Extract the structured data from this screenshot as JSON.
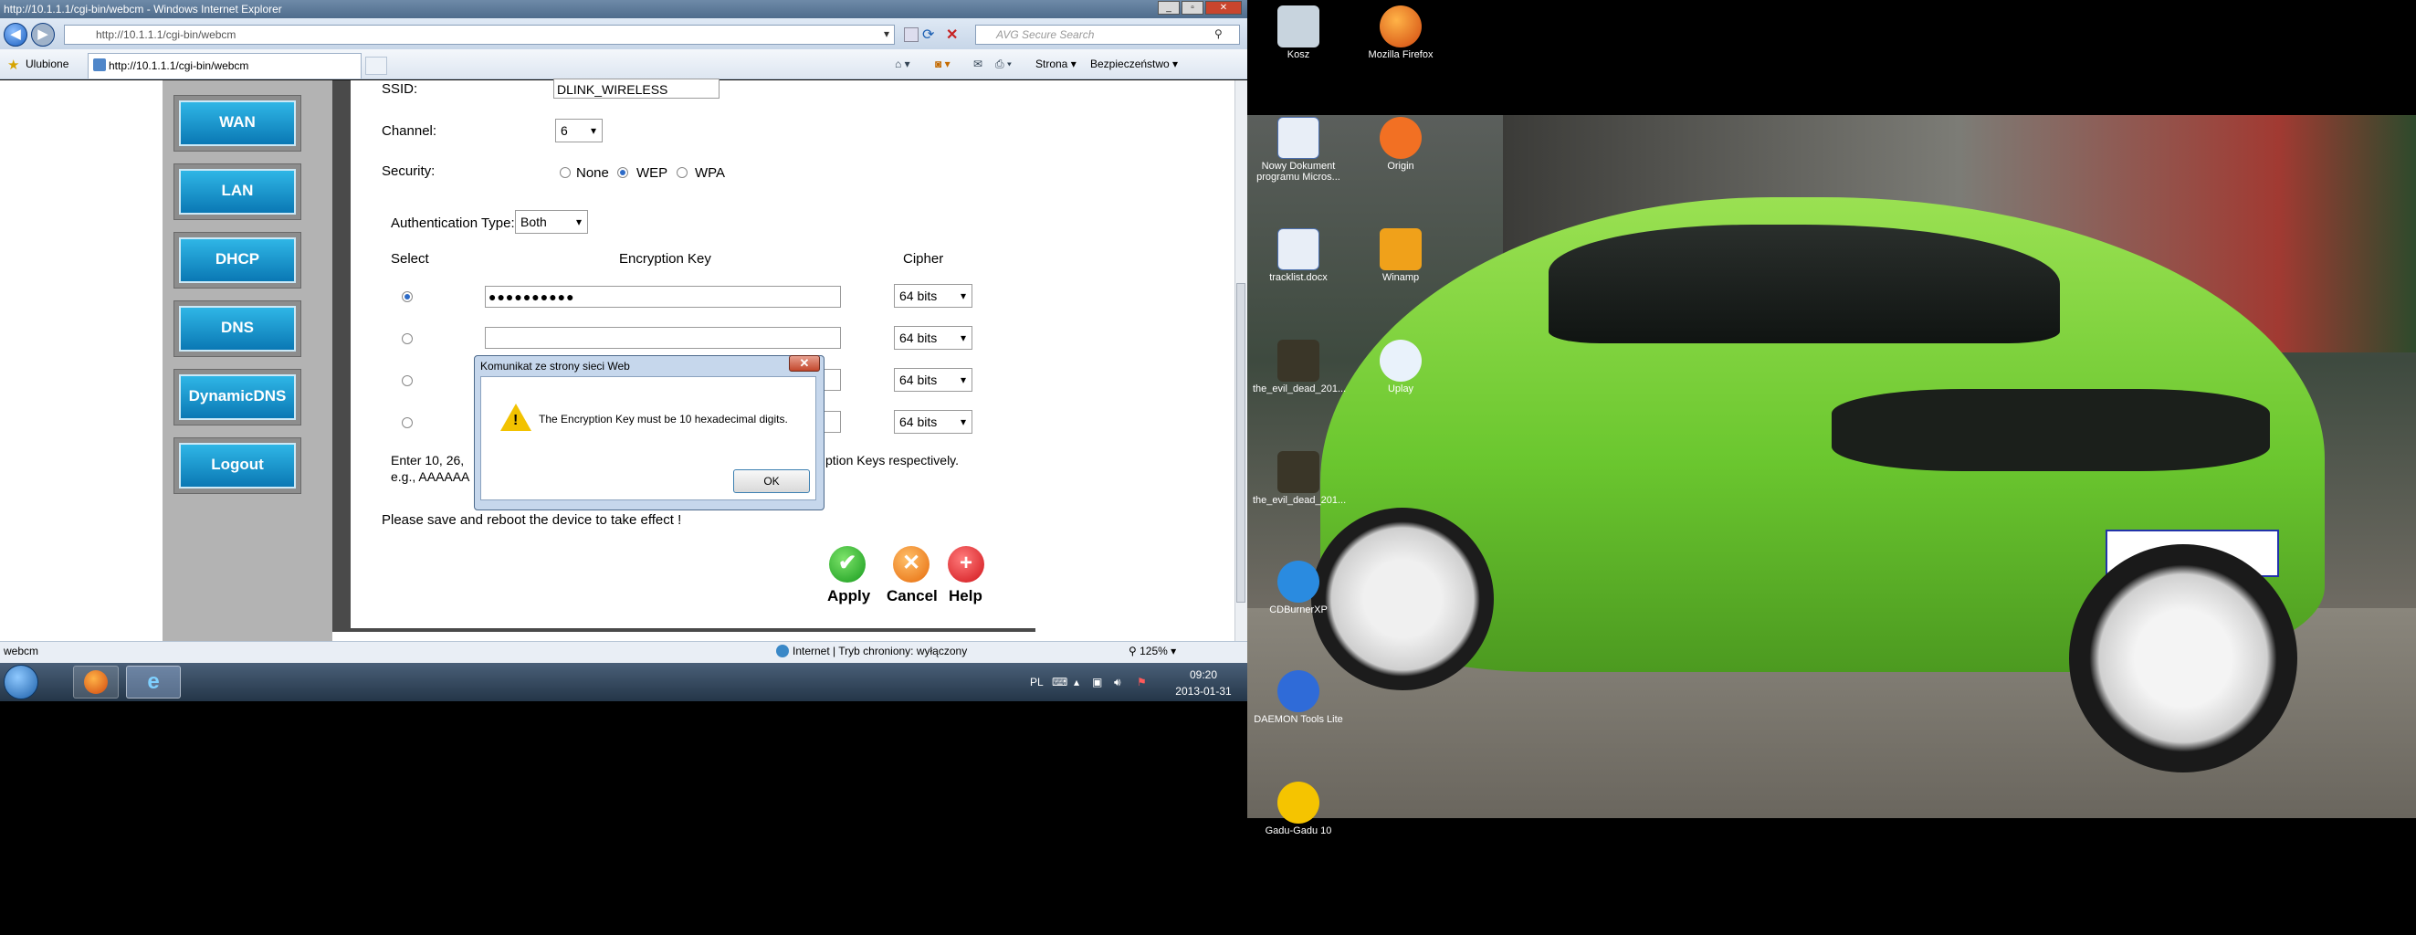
{
  "ie": {
    "title": "http://10.1.1.1/cgi-bin/webcm - Windows Internet Explorer",
    "url": "http://10.1.1.1/cgi-bin/webcm",
    "search_placeholder": "AVG Secure Search",
    "favorites": "Ulubione",
    "tab_title": "http://10.1.1.1/cgi-bin/webcm",
    "toolbar": {
      "page": "Strona",
      "safety": "Bezpieczeństwo"
    },
    "status_left": "webcm",
    "status_zone": "Internet | Tryb chroniony: wyłączony",
    "zoom": "125%"
  },
  "nav": [
    "WAN",
    "LAN",
    "DHCP",
    "DNS",
    "DynamicDNS",
    "Logout"
  ],
  "form": {
    "ssid_label": "SSID:",
    "ssid_value": "DLINK_WIRELESS",
    "channel_label": "Channel:",
    "channel_value": "6",
    "security_label": "Security:",
    "security_options": [
      "None",
      "WEP",
      "WPA"
    ],
    "security_selected": "WEP",
    "auth_label": "Authentication Type:",
    "auth_value": "Both",
    "col_select": "Select",
    "col_key": "Encryption Key",
    "col_cipher": "Cipher",
    "keys": [
      {
        "value": "●●●●●●●●●●",
        "cipher": "64 bits",
        "selected": true
      },
      {
        "value": "",
        "cipher": "64 bits",
        "selected": false
      },
      {
        "value": "",
        "cipher": "64 bits",
        "selected": false
      },
      {
        "value": "",
        "cipher": "64 bits",
        "selected": false
      }
    ],
    "note_line1_start": "Enter 10, 26,",
    "note_line1_end": "ption Keys respectively.",
    "note_line2": "e.g., AAAAAA",
    "reboot_note": "Please save and reboot the device to take effect !",
    "apply": "Apply",
    "cancel": "Cancel",
    "help": "Help"
  },
  "dialog": {
    "title": "Komunikat ze strony sieci Web",
    "message": "The Encryption Key must be 10 hexadecimal digits.",
    "ok": "OK"
  },
  "taskbar": {
    "lang": "PL",
    "time": "09:20",
    "date": "2013-01-31"
  },
  "desktop_icons": [
    {
      "label": "Kosz",
      "icon": "recycle-bin-icon",
      "color": "#c8d4de"
    },
    {
      "label": "Mozilla Firefox",
      "icon": "firefox-icon",
      "color": "#e66a1f"
    },
    {
      "label": "Nowy Dokument programu Micros...",
      "icon": "word-doc-icon",
      "color": "#e8eef7"
    },
    {
      "label": "Origin",
      "icon": "origin-icon",
      "color": "#f27023"
    },
    {
      "label": "tracklist.docx",
      "icon": "word-doc-icon",
      "color": "#e8eef7"
    },
    {
      "label": "Winamp",
      "icon": "winamp-icon",
      "color": "#f0a11a"
    },
    {
      "label": "the_evil_dead_201...",
      "icon": "video-file-icon",
      "color": "#3a3628"
    },
    {
      "label": "Uplay",
      "icon": "uplay-icon",
      "color": "#e9f2fb"
    },
    {
      "label": "the_evil_dead_201...",
      "icon": "video-file-icon",
      "color": "#3a3628"
    },
    {
      "label": "CDBurnerXP",
      "icon": "cdburner-icon",
      "color": "#2a8be0"
    },
    {
      "label": "DAEMON Tools Lite",
      "icon": "daemon-tools-icon",
      "color": "#2f6bd8"
    },
    {
      "label": "Gadu-Gadu 10",
      "icon": "gadu-gadu-icon",
      "color": "#f5c400"
    }
  ],
  "colors": {
    "nav_button": "#0a78b4",
    "car": "#7bd33a",
    "titlebar": "#4f6c8c"
  }
}
